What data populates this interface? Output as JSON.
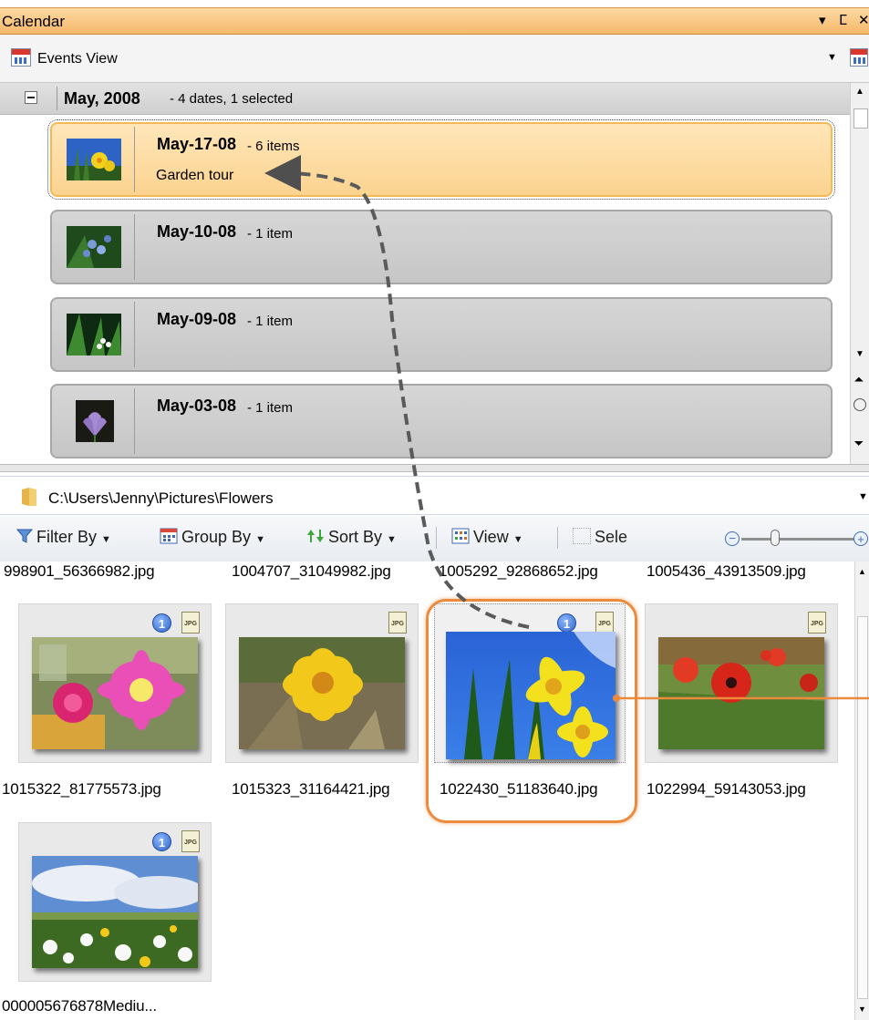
{
  "calendar_pane": {
    "title": "Calendar",
    "pin_glyph": "▾  ⵎ ✕",
    "view_selector": "Events View",
    "month_group": {
      "month": "May, 2008",
      "summary": "- 4 dates, 1 selected"
    },
    "dates": [
      {
        "date": "May-17-08",
        "count": "- 6 items",
        "note": "Garden tour",
        "selected": true
      },
      {
        "date": "May-10-08",
        "count": "- 1 item",
        "note": ""
      },
      {
        "date": "May-09-08",
        "count": "- 1 item",
        "note": ""
      },
      {
        "date": "May-03-08",
        "count": "- 1 item",
        "note": ""
      }
    ]
  },
  "folder_pane": {
    "path": "C:\\Users\\Jenny\\Pictures\\Flowers",
    "toolbar": {
      "filter": "Filter By",
      "group": "Group By",
      "sort": "Sort By",
      "view": "View",
      "select": "Sele"
    },
    "top_captions": [
      "998901_56366982.jpg",
      "1004707_31049982.jpg",
      "1005292_92868652.jpg",
      "1005436_43913509.jpg"
    ],
    "thumbnails": [
      {
        "file": "1015322_81775573.jpg",
        "badge": "1",
        "type": "JPG"
      },
      {
        "file": "1015323_31164421.jpg",
        "badge": "",
        "type": "JPG"
      },
      {
        "file": "1022430_51183640.jpg",
        "badge": "1",
        "type": "JPG",
        "selected": true
      },
      {
        "file": "1022994_59143053.jpg",
        "badge": "",
        "type": "JPG"
      },
      {
        "file": "000005676878Mediu...",
        "badge": "1",
        "type": "JPG"
      }
    ]
  },
  "colors": {
    "titlebar": "#f6b96a",
    "selected_item": "#fbd390",
    "highlight_ring": "#ec8a3d",
    "arrow": "#555555",
    "badge": "#2c63c7"
  },
  "icons": [
    "calendar-icon",
    "folder-icon",
    "filter-icon",
    "group-icon",
    "sort-icon",
    "view-icon",
    "select-icon",
    "zoom-out-icon",
    "zoom-in-icon",
    "collapse-icon",
    "info-badge-icon",
    "jpg-file-icon"
  ]
}
